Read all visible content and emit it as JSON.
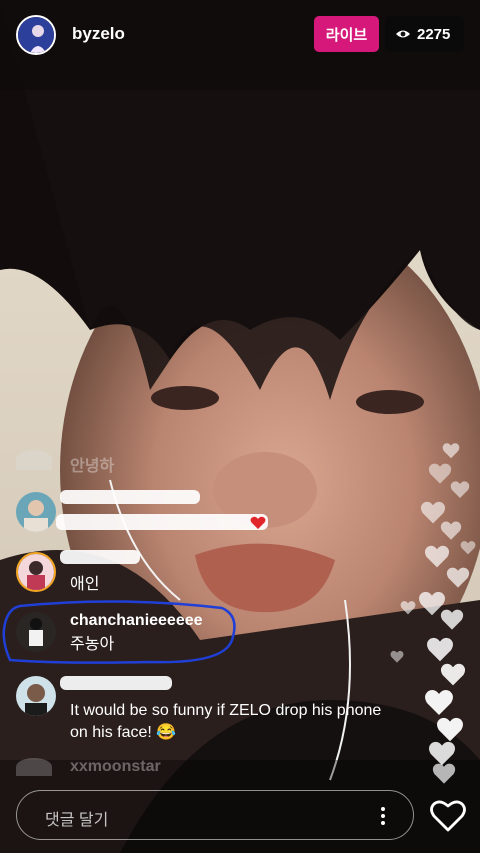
{
  "header": {
    "username": "byzelo",
    "live_label": "라이브",
    "viewer_count": "2275"
  },
  "comments": [
    {
      "user": "",
      "text": "안녕하"
    },
    {
      "user": "",
      "text": ""
    },
    {
      "user": "",
      "text": "애인"
    },
    {
      "user": "chanchanieeeeee",
      "text": "주농아"
    },
    {
      "user": "",
      "text": "It would be so funny if ZELO drop his phone on his face! 😂"
    },
    {
      "user": "xxmoonstar",
      "text": ""
    }
  ],
  "input": {
    "placeholder": "댓글 달기"
  },
  "colors": {
    "live_badge": "#d6187a",
    "highlight_circle": "#1f3fd6",
    "heart": "#ffffff"
  },
  "icons": {
    "viewer": "eye-icon",
    "more": "more-vertical-icon",
    "like": "heart-outline-icon"
  }
}
